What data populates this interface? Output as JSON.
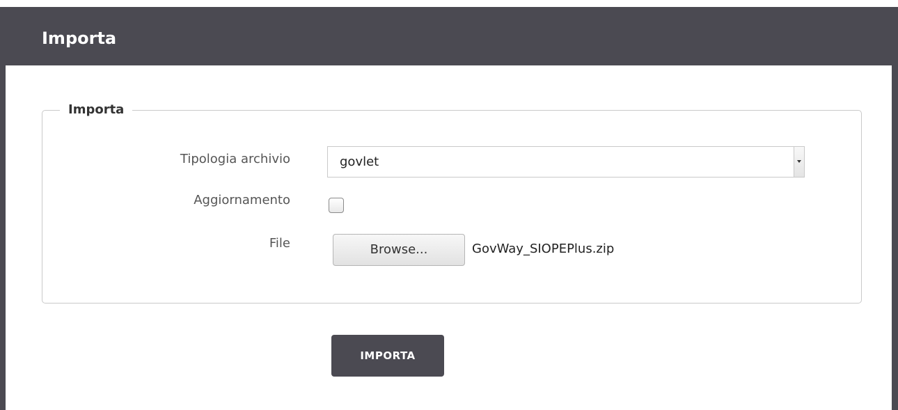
{
  "header": {
    "title": "Importa"
  },
  "form": {
    "legend": "Importa",
    "fields": {
      "tipologia": {
        "label": "Tipologia archivio",
        "value": "govlet"
      },
      "aggiornamento": {
        "label": "Aggiornamento",
        "checked": false
      },
      "file": {
        "label": "File",
        "browse_label": "Browse...",
        "file_name": "GovWay_SIOPEPlus.zip"
      }
    },
    "submit_label": "IMPORTA"
  },
  "colors": {
    "header_bg": "#4b4a52",
    "button_bg": "#4b4a52",
    "fieldset_border": "#c9c9c9"
  }
}
